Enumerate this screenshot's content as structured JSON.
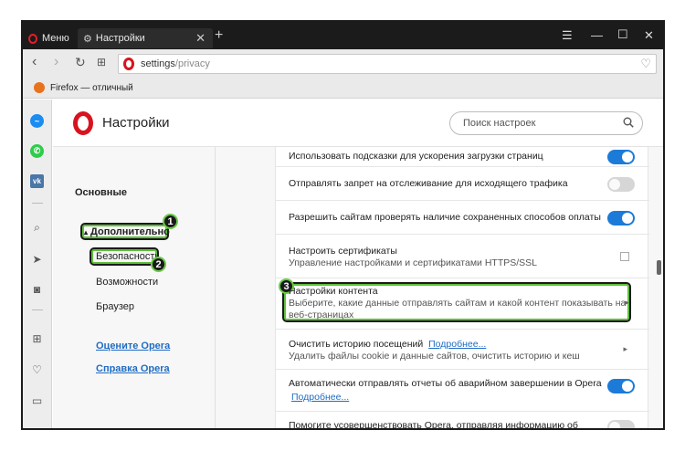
{
  "titlebar": {
    "menu_label": "Меню",
    "tab_title": "Настройки",
    "close_tab": "✕",
    "new_tab": "+"
  },
  "navbar": {
    "url_main": "settings",
    "url_path": "/privacy"
  },
  "bookmarks": {
    "item": "Firefox — отличный"
  },
  "header": {
    "title": "Настройки",
    "search_placeholder": "Поиск настроек"
  },
  "leftnav": {
    "basic": "Основные",
    "advanced": "Дополнительно",
    "security": "Безопасность",
    "features": "Возможности",
    "browser": "Браузер",
    "rate": "Оцените Opera",
    "help": "Справка Opera"
  },
  "callouts": [
    "1",
    "2",
    "3"
  ],
  "settings": [
    {
      "title": "Использовать подсказки для ускорения загрузки страниц",
      "toggle": "on"
    },
    {
      "title": "Отправлять запрет на отслеживание для исходящего трафика",
      "toggle": "off"
    },
    {
      "title": "Разрешить сайтам проверять наличие сохраненных способов оплаты",
      "toggle": "on"
    },
    {
      "title": "Настроить сертификаты",
      "sub": "Управление настройками и сертификатами HTTPS/SSL"
    },
    {
      "title": "Настройки контента",
      "sub": "Выберите, какие данные отправлять сайтам и какой контент показывать на",
      "sub2": "веб-страницах"
    },
    {
      "title": "Очистить историю посещений",
      "link": "Подробнее...",
      "sub": "Удалить файлы cookie и данные сайтов, очистить историю и кеш"
    },
    {
      "title": "Автоматически отправлять отчеты об аварийном завершении в Opera",
      "link": "Подробнее...",
      "toggle": "on"
    },
    {
      "title": "Помогите усовершенствовать Opera, отправляя информацию об",
      "toggle": "off"
    }
  ],
  "colors": {
    "accent": "#1c7bd8",
    "opera_red": "#d8131f",
    "callout_green": "#6cc94a"
  }
}
